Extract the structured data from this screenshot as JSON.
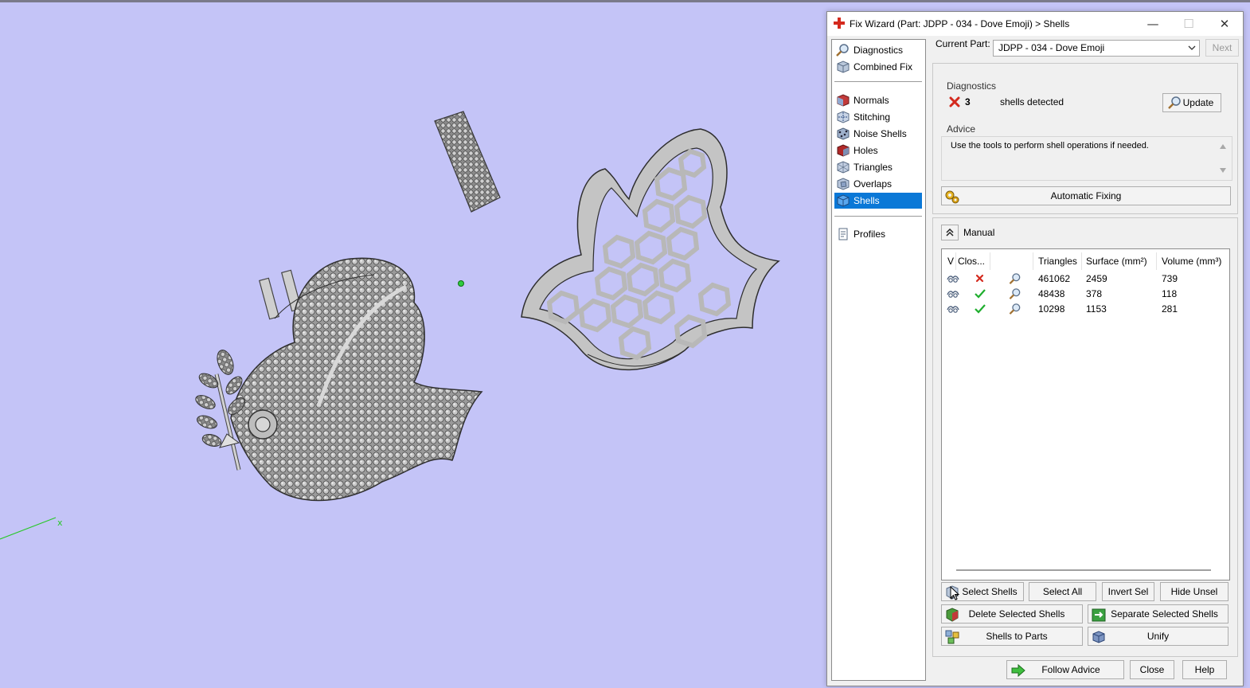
{
  "window": {
    "title": "Fix Wizard (Part: JDPP - 034 - Dove Emoji) > Shells",
    "minimize_label": "—",
    "maximize_label": "☐",
    "close_label": "✕"
  },
  "nav": {
    "top_items": [
      {
        "label": "Diagnostics",
        "icon": "magnifier-icon"
      },
      {
        "label": "Combined Fix",
        "icon": "cube-icon"
      }
    ],
    "items": [
      {
        "label": "Normals",
        "icon": "normals-icon"
      },
      {
        "label": "Stitching",
        "icon": "stitching-icon"
      },
      {
        "label": "Noise Shells",
        "icon": "noise-shells-icon"
      },
      {
        "label": "Holes",
        "icon": "holes-icon"
      },
      {
        "label": "Triangles",
        "icon": "triangles-icon"
      },
      {
        "label": "Overlaps",
        "icon": "overlaps-icon"
      },
      {
        "label": "Shells",
        "icon": "shells-icon",
        "selected": true
      }
    ],
    "bottom_items": [
      {
        "label": "Profiles",
        "icon": "profiles-icon"
      }
    ]
  },
  "current_part": {
    "label": "Current Part:",
    "value": "JDPP - 034 - Dove Emoji",
    "next_label": "Next"
  },
  "diagnostics": {
    "title": "Diagnostics",
    "count": "3",
    "text": "shells detected",
    "update_label": "Update"
  },
  "advice": {
    "title": "Advice",
    "text": "Use the tools to perform shell operations if needed."
  },
  "automatic_fixing_label": "Automatic Fixing",
  "manual": {
    "label": "Manual",
    "columns": [
      "V",
      "Clos...",
      "",
      "Triangles",
      "Surface (mm²)",
      "Volume (mm³)"
    ],
    "rows": [
      {
        "closed": false,
        "triangles": "461062",
        "surface": "2459",
        "volume": "739"
      },
      {
        "closed": true,
        "triangles": "48438",
        "surface": "378",
        "volume": "118"
      },
      {
        "closed": true,
        "triangles": "10298",
        "surface": "1153",
        "volume": "281"
      }
    ]
  },
  "buttons": {
    "select_shells": "Select Shells",
    "select_all": "Select All",
    "invert_sel": "Invert Sel",
    "hide_unsel": "Hide Unsel",
    "delete_selected_shells": "Delete Selected Shells",
    "separate_selected_shells": "Separate Selected Shells",
    "shells_to_parts": "Shells to Parts",
    "unify": "Unify",
    "follow_advice": "Follow Advice",
    "close": "Close",
    "help": "Help"
  },
  "colors": {
    "viewport_background": "#c4c4f7",
    "selection": "#0a78d7",
    "error": "#d42a1e",
    "ok": "#1fae2e"
  }
}
